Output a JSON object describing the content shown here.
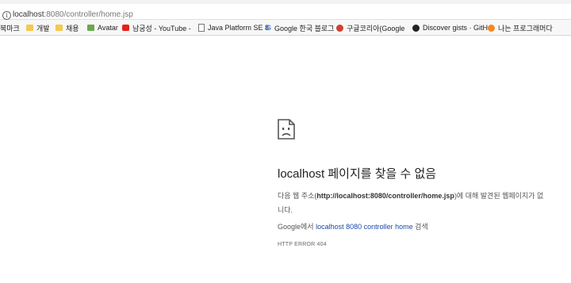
{
  "address_bar": {
    "host": "localhost",
    "path": ":8080/controller/home.jsp"
  },
  "bookmarks": [
    {
      "label": "북마크",
      "icon": "none"
    },
    {
      "label": "개발",
      "icon": "folder-icon"
    },
    {
      "label": "채용",
      "icon": "folder-icon"
    },
    {
      "label": "Avatar",
      "icon": "avatar-icon"
    },
    {
      "label": "남궁성 - YouTube -",
      "icon": "youtube-icon"
    },
    {
      "label": "Java Platform SE 8",
      "icon": "document-icon"
    },
    {
      "label": "Google 한국 블로그",
      "icon": "google-icon"
    },
    {
      "label": "구글코리아(Google",
      "icon": "google-plus-icon"
    },
    {
      "label": "Discover gists · GitH",
      "icon": "github-icon"
    },
    {
      "label": "나는 프로그래머다",
      "icon": "podcast-icon"
    }
  ],
  "error_page": {
    "title": "localhost 페이지를 찾을 수 없음",
    "desc_prefix": "다음 웹 주소(",
    "desc_url": "http://localhost:8080/controller/home.jsp",
    "desc_suffix": ")에 대해 발견된 웹페이지가 없",
    "desc_line2": "니다.",
    "search_prefix": "Google에서 ",
    "search_link": "localhost 8080 controller home",
    "search_suffix": " 검색",
    "error_code": "HTTP ERROR 404"
  }
}
